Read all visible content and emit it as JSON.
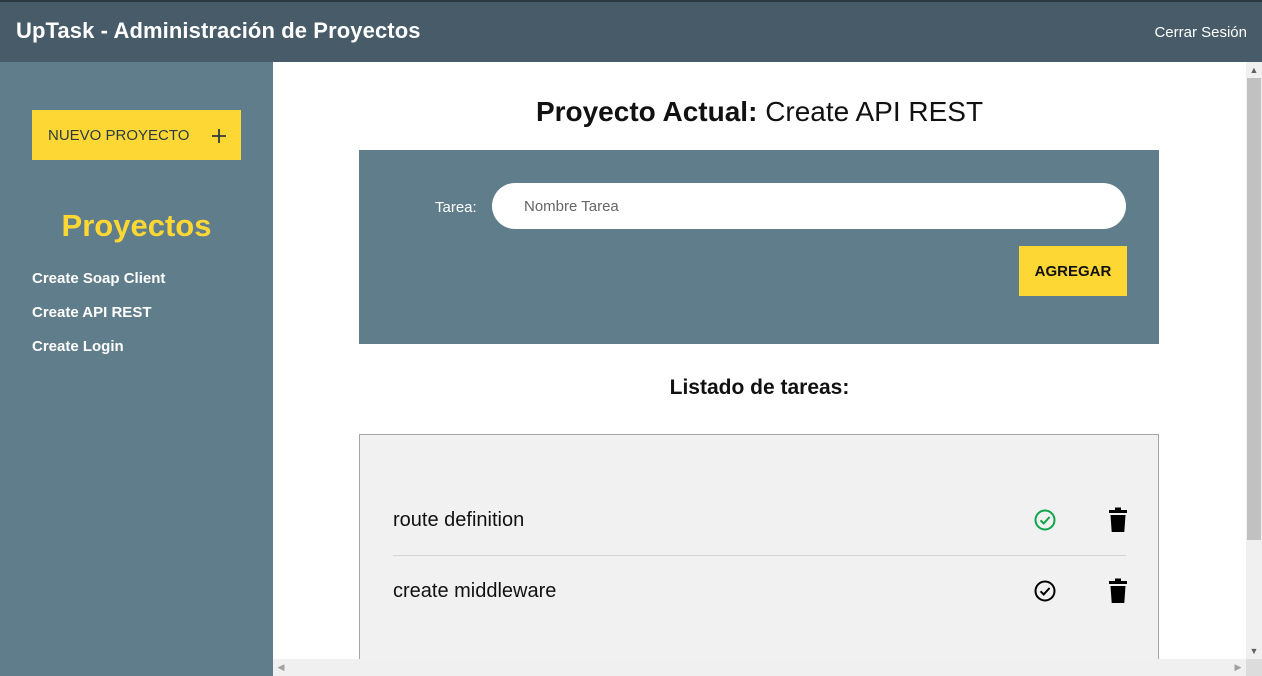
{
  "header": {
    "title": "UpTask - Administración de Proyectos",
    "logout_label": "Cerrar Sesión"
  },
  "sidebar": {
    "new_project_label": "NUEVO PROYECTO",
    "new_project_icon": "plus-icon",
    "heading": "Proyectos",
    "projects": [
      {
        "label": "Create Soap Client"
      },
      {
        "label": "Create API REST"
      },
      {
        "label": "Create Login"
      }
    ]
  },
  "main": {
    "title_label": "Proyecto Actual:",
    "title_value": "Create API REST",
    "form": {
      "field_label": "Tarea:",
      "placeholder": "Nombre Tarea",
      "submit_label": "AGREGAR"
    },
    "list_heading": "Listado de tareas:",
    "tasks": [
      {
        "name": "route definition",
        "status": "completed",
        "status_icon": "check-circle-icon",
        "status_color": "#11a34a",
        "delete_icon": "trash-icon"
      },
      {
        "name": "create middleware",
        "status": "pending",
        "status_icon": "check-circle-icon",
        "status_color": "#000000",
        "delete_icon": "trash-icon"
      }
    ]
  },
  "colors": {
    "header_bg": "#475b68",
    "sidebar_bg": "#607d8b",
    "accent": "#fdd835",
    "panel_bg": "#607d8b",
    "list_bg": "#f1f1f1"
  }
}
